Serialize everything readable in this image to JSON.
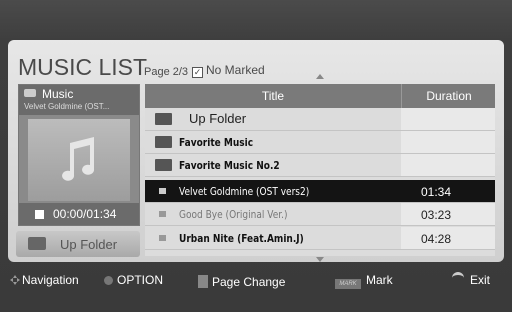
{
  "header": {
    "title": "MUSIC LIST",
    "page_info": "Page 2/3",
    "marked_status": "No Marked"
  },
  "preview": {
    "label": "Music",
    "track": "Velvet Goldmine (OST...",
    "time": "00:00/01:34",
    "up_folder_label": "Up Folder"
  },
  "list": {
    "headers": {
      "title": "Title",
      "duration": "Duration"
    },
    "rows": [
      {
        "name": "Up Folder",
        "duration": "",
        "type": "up-folder"
      },
      {
        "name": "Favorite Music",
        "duration": "",
        "type": "folder"
      },
      {
        "name": "Favorite Music No.2",
        "duration": "",
        "type": "folder"
      },
      {
        "name": "Velvet Goldmine (OST vers2)",
        "duration": "01:34",
        "type": "music",
        "selected": true
      },
      {
        "name": "Good Bye (Original Ver.)",
        "duration": "03:23",
        "type": "music"
      },
      {
        "name": "Urban Nite (Feat.Amin.J)",
        "duration": "04:28",
        "type": "music"
      }
    ]
  },
  "footer": {
    "navigation": "Navigation",
    "option": "OPTION",
    "page_change": "Page Change",
    "mark_key": "MARK",
    "mark": "Mark",
    "exit": "Exit"
  },
  "colors": {
    "selected_row": "#141414",
    "panel": "#dcdcdc"
  }
}
